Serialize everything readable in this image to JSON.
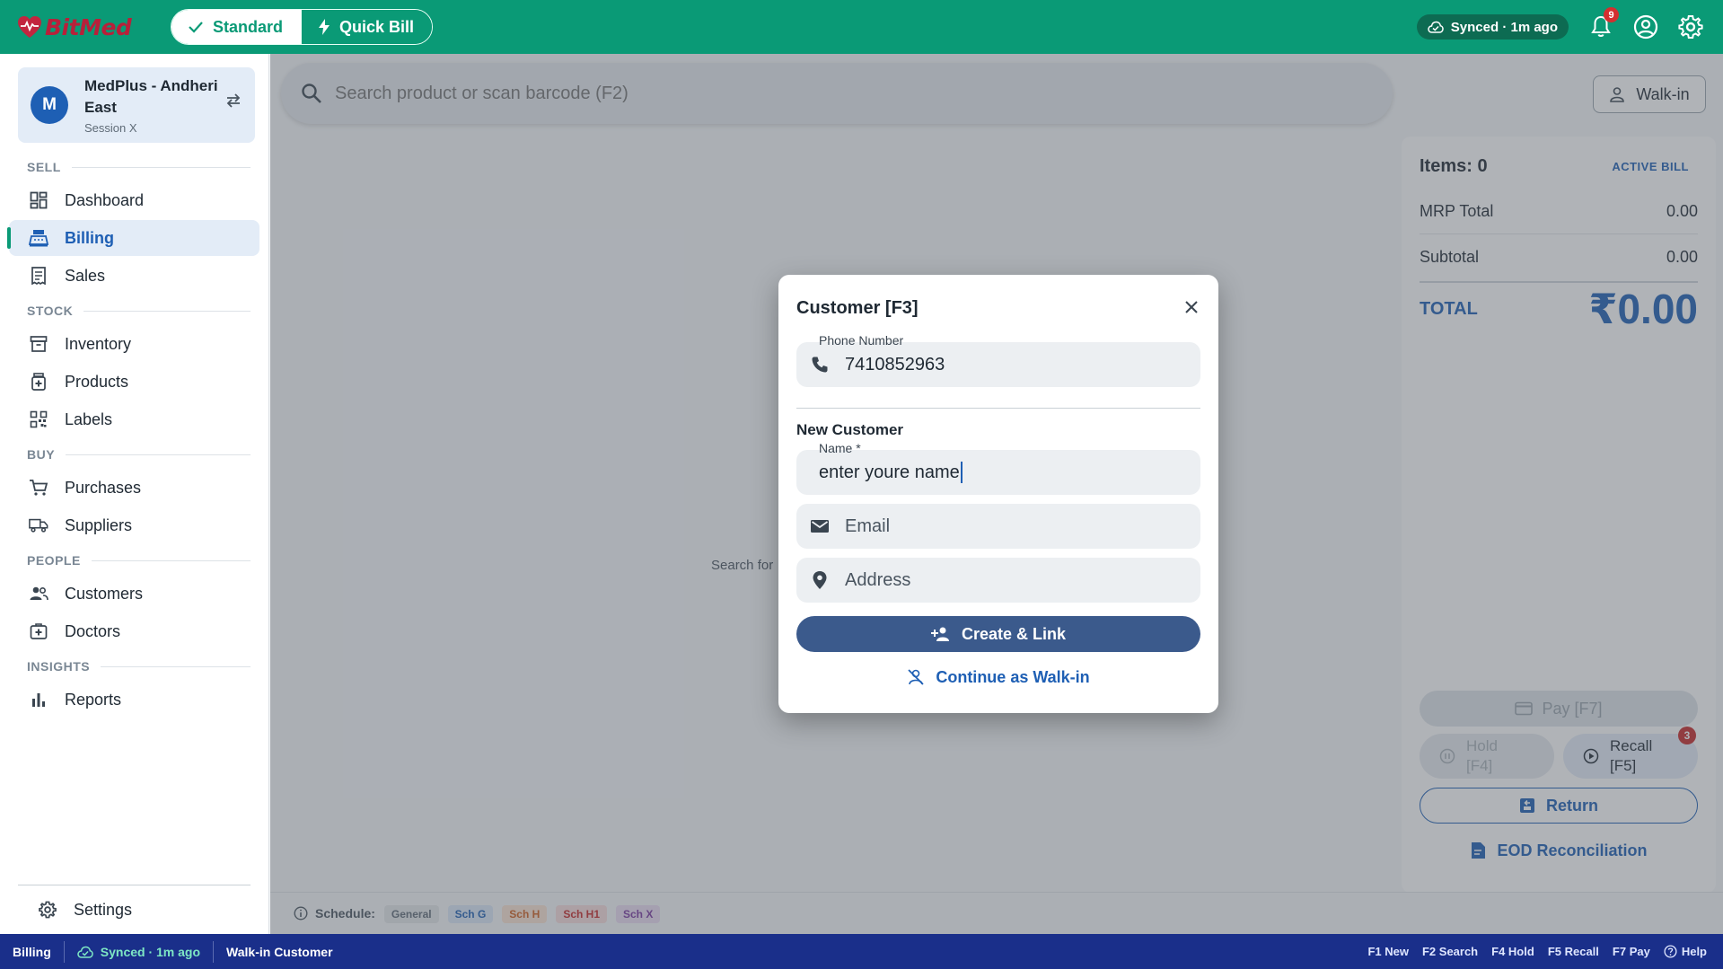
{
  "header": {
    "brand": "BitMed",
    "mode_standard": "Standard",
    "mode_quick": "Quick Bill",
    "sync_status": "Synced · 1m ago",
    "notification_count": "9",
    "colors": {
      "primary": "#0a9a76",
      "accent_blue": "#1e5fb4",
      "status_bar": "#1a2f8a",
      "danger": "#d32f2f"
    }
  },
  "sidebar": {
    "store_avatar": "M",
    "store_name": "MedPlus - Andheri East",
    "session": "Session X",
    "sections": {
      "sell": "SELL",
      "stock": "STOCK",
      "buy": "BUY",
      "people": "PEOPLE",
      "insights": "INSIGHTS"
    },
    "items": {
      "dashboard": "Dashboard",
      "billing": "Billing",
      "sales": "Sales",
      "inventory": "Inventory",
      "products": "Products",
      "labels": "Labels",
      "purchases": "Purchases",
      "suppliers": "Suppliers",
      "customers": "Customers",
      "doctors": "Doctors",
      "reports": "Reports",
      "settings": "Settings"
    },
    "active_item": "Billing"
  },
  "main": {
    "search_placeholder": "Search product or scan barcode (F2)",
    "walkin_label": "Walk-in",
    "empty_hint": "Search for"
  },
  "bill": {
    "items_label": "Items: 0",
    "active_bill": "ACTIVE BILL",
    "mrp_total_label": "MRP Total",
    "mrp_total_value": "0.00",
    "subtotal_label": "Subtotal",
    "subtotal_value": "0.00",
    "total_label": "TOTAL",
    "total_value": "₹0.00",
    "pay_label": "Pay  [F7]",
    "hold_line1": "Hold",
    "hold_line2": "[F4]",
    "recall_line1": "Recall",
    "recall_line2": "[F5]",
    "recall_badge": "3",
    "return_label": "Return",
    "eod_label": "EOD Reconciliation"
  },
  "schedule": {
    "label": "Schedule:",
    "chips": [
      {
        "label": "General",
        "bg": "#e4e7ea",
        "fg": "#5f6b77"
      },
      {
        "label": "Sch G",
        "bg": "#dbe8f7",
        "fg": "#1e5fb4"
      },
      {
        "label": "Sch H",
        "bg": "#fbe3d3",
        "fg": "#d0601f"
      },
      {
        "label": "Sch H1",
        "bg": "#f8dcdc",
        "fg": "#c62828"
      },
      {
        "label": "Sch X",
        "bg": "#ebdcf3",
        "fg": "#7b3aa0"
      }
    ]
  },
  "modal": {
    "title": "Customer  [F3]",
    "phone_label": "Phone Number",
    "phone_value": "7410852963",
    "new_customer_heading": "New Customer",
    "name_label": "Name *",
    "name_value": "enter youre name",
    "email_placeholder": "Email",
    "address_placeholder": "Address",
    "create_label": "Create & Link",
    "continue_label": "Continue as Walk-in"
  },
  "statusbar": {
    "page": "Billing",
    "sync": "Synced · 1m ago",
    "customer": "Walk-in Customer",
    "shortcuts": [
      "F1 New",
      "F2 Search",
      "F4 Hold",
      "F5 Recall",
      "F7 Pay"
    ],
    "help": "Help"
  }
}
